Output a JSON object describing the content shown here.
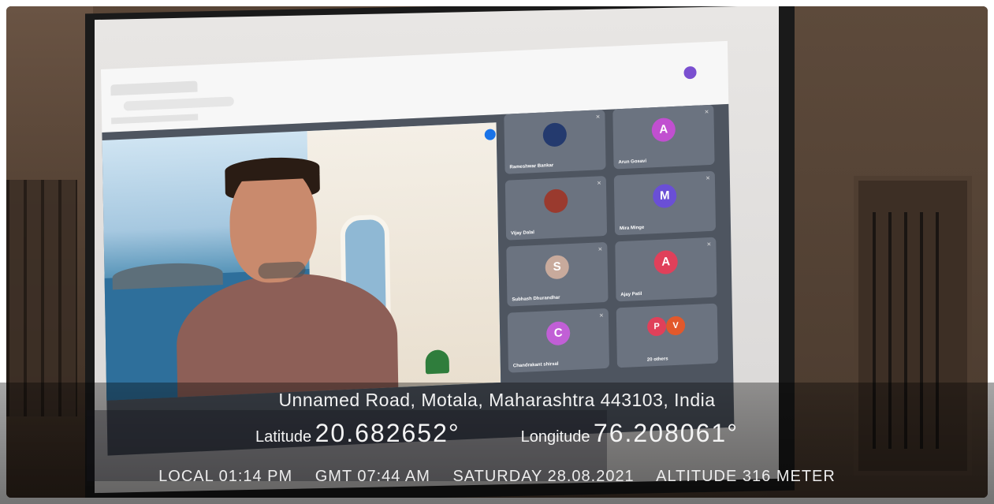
{
  "participants": [
    {
      "name": "Rameshwar Bankar",
      "initial": "",
      "color": "#243a6e"
    },
    {
      "name": "Arun Gosavi",
      "initial": "A",
      "color": "#c14fd0"
    },
    {
      "name": "Vijay Dalal",
      "initial": "",
      "color": "#9a3a2e"
    },
    {
      "name": "Mira Minge",
      "initial": "M",
      "color": "#6a4fd6"
    },
    {
      "name": "Subhash Dhurandhar",
      "initial": "S",
      "color": "#c8aa9c"
    },
    {
      "name": "Ajay Patil",
      "initial": "A",
      "color": "#e0405a"
    },
    {
      "name": "Chandrakant shirsal",
      "initial": "C",
      "color": "#c15fd6"
    },
    {
      "name": "20 others",
      "initial": "",
      "color": "#e24b4b"
    }
  ],
  "others_initials": [
    "P",
    "V"
  ],
  "others_colors": [
    "#e0405a",
    "#e2582b"
  ],
  "stamp": {
    "address": "Unnamed Road, Motala, Maharashtra 443103, India",
    "lat_label": "Latitude",
    "lat_value": "20.682652°",
    "lon_label": "Longitude",
    "lon_value": "76.208061°",
    "local_time": "LOCAL 01:14 PM",
    "gmt_time": "GMT 07:44 AM",
    "day_date": "SATURDAY 28.08.2021",
    "altitude": "ALTITUDE 316 METER"
  }
}
